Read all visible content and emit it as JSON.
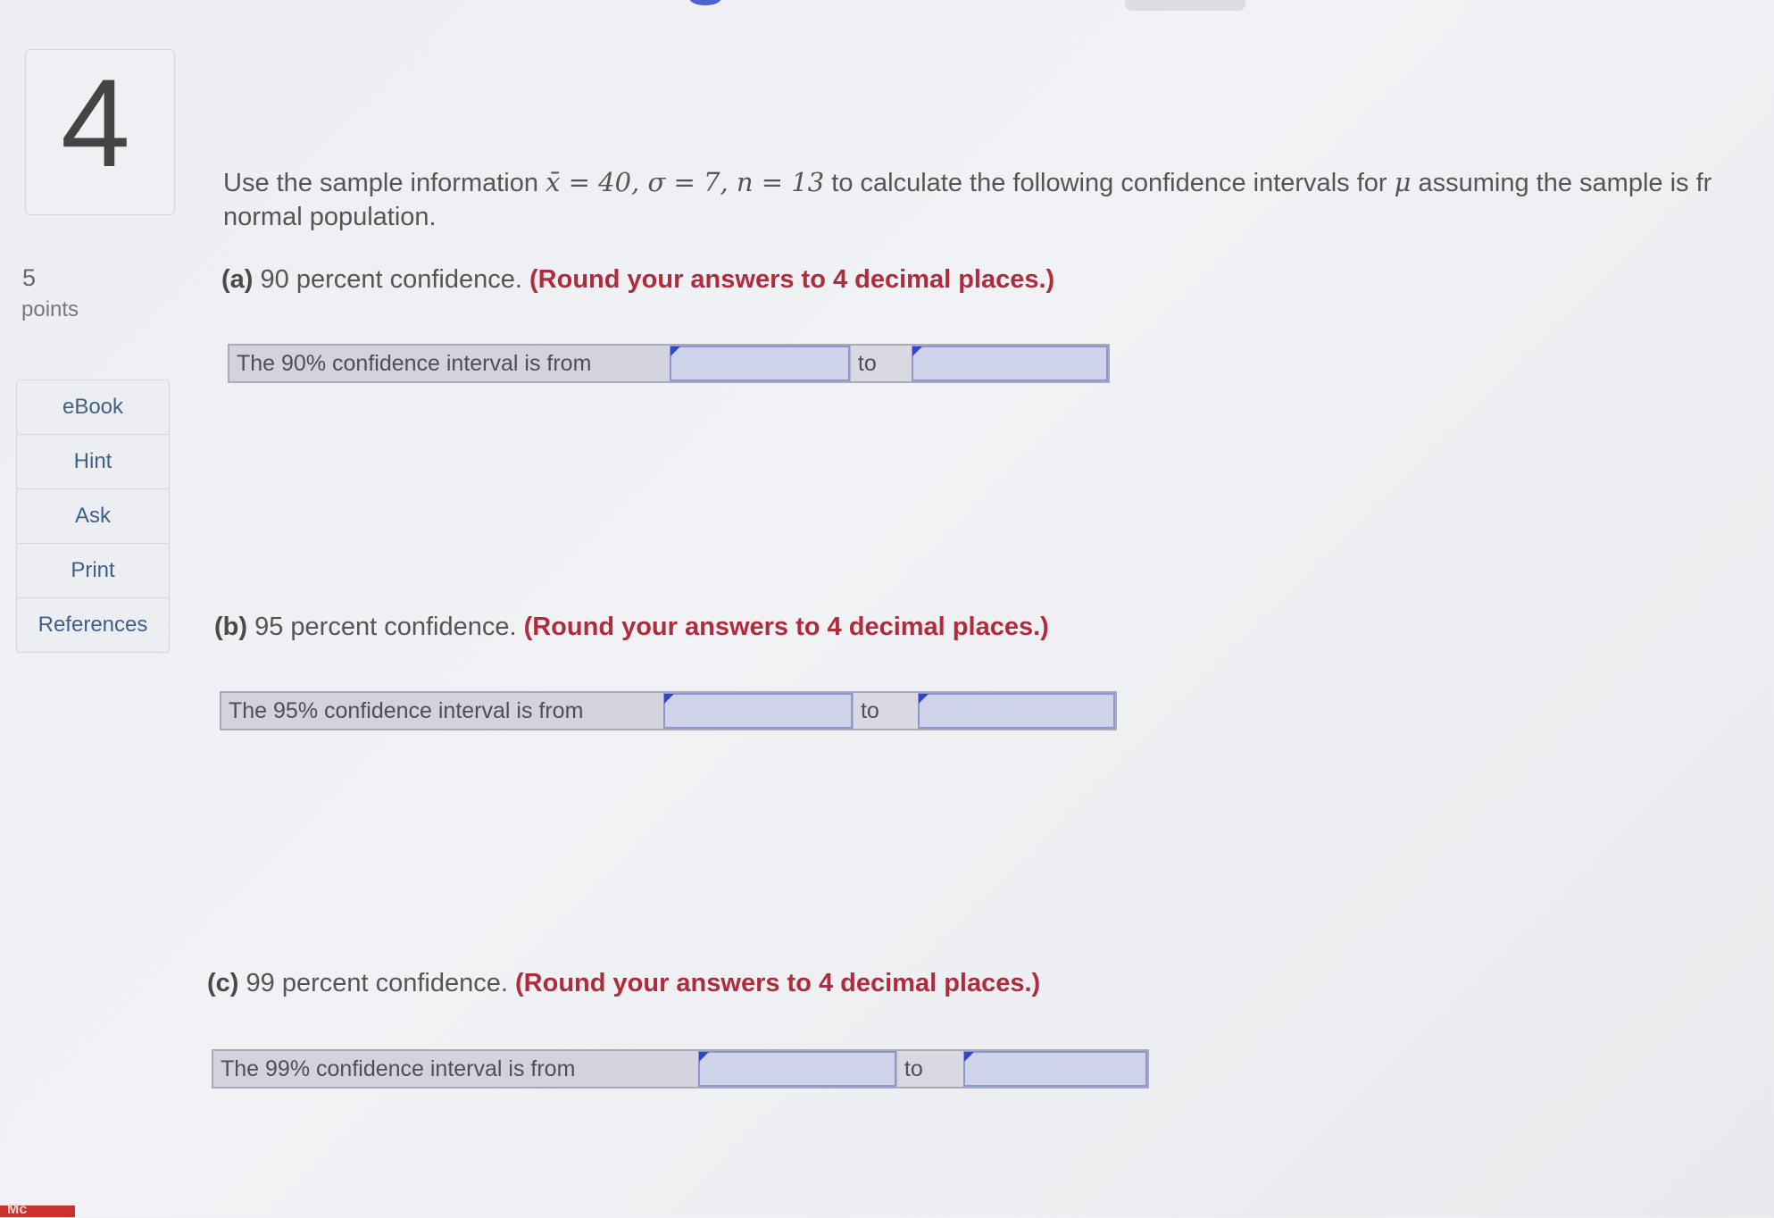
{
  "question": {
    "number": "4",
    "points_value": "5",
    "points_label": "points",
    "intro_line1_prefix": "Use the sample information ",
    "intro_math": "x̄ = 40, σ = 7, n = 13",
    "intro_line1_suffix": " to calculate the following confidence intervals for ",
    "intro_mu": "μ",
    "intro_line1_end": " assuming the sample is fr",
    "intro_line2": "normal population."
  },
  "sidebar": {
    "items": [
      {
        "label": "eBook"
      },
      {
        "label": "Hint"
      },
      {
        "label": "Ask"
      },
      {
        "label": "Print"
      },
      {
        "label": "References"
      }
    ]
  },
  "parts": [
    {
      "letter": "(a)",
      "text": " 90 percent confidence. ",
      "instruction": "(Round your answers to 4 decimal places.)",
      "row_label": "The 90% confidence interval is from",
      "to_label": "to",
      "lower_value": "",
      "upper_value": ""
    },
    {
      "letter": "(b)",
      "text": " 95 percent confidence. ",
      "instruction": "(Round your answers to 4 decimal places.)",
      "row_label": "The 95% confidence interval is from",
      "to_label": "to",
      "lower_value": "",
      "upper_value": ""
    },
    {
      "letter": "(c)",
      "text": " 99 percent confidence. ",
      "instruction": "(Round your answers to 4 decimal places.)",
      "row_label": "The 99% confidence interval is from",
      "to_label": "to",
      "lower_value": "",
      "upper_value": ""
    }
  ],
  "footer": {
    "logo_text": "Mc"
  }
}
